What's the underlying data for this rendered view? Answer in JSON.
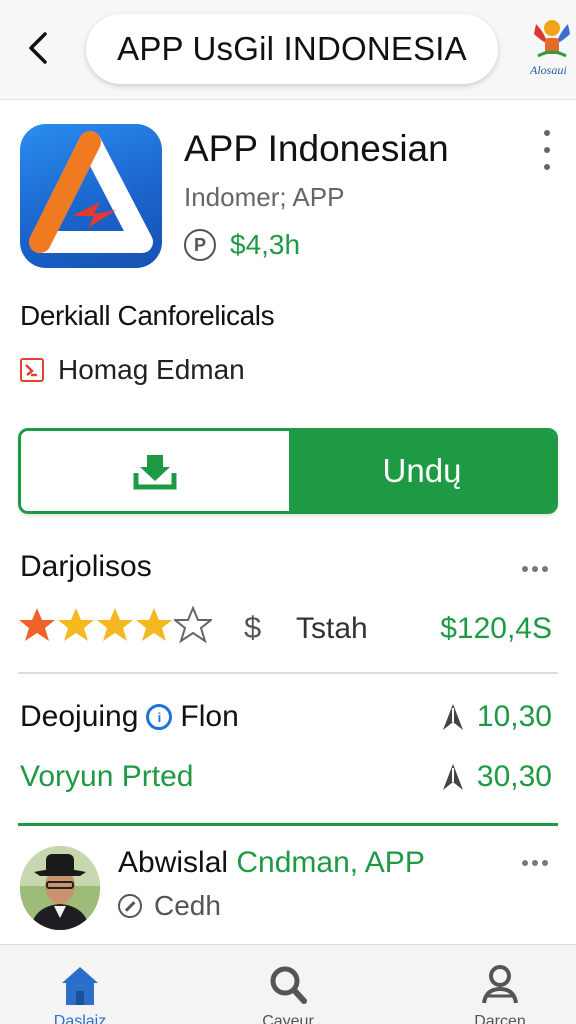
{
  "header": {
    "title": "APP UsGil INDONESIA",
    "brand_text": "Alosaui"
  },
  "app": {
    "name": "APP Indonesian",
    "developer": "Indomer; APP",
    "price_badge": "P",
    "price": "$4,3h",
    "category": "Derkiall Canforelicals",
    "author": "Homag Edman"
  },
  "actions": {
    "install_label": "Undų"
  },
  "ratings": {
    "section_title": "Darjolisos",
    "stars": 4,
    "max_stars": 5,
    "currency_symbol": "$",
    "label": "Tstah",
    "amount": "$120,4S"
  },
  "stats": [
    {
      "label": "Deojuing",
      "icon": "info-circle-icon",
      "label_suffix": "Flon",
      "value": "10,30",
      "label_color": "#111111"
    },
    {
      "label": "Voryun Prted",
      "icon": "",
      "label_suffix": "",
      "value": "30,30",
      "label_color": "#1f9a44"
    }
  ],
  "review": {
    "reviewer": "Abwislal",
    "organization": "Cndman, APP",
    "meta": "Cedh"
  },
  "bottom_nav": [
    {
      "label": "Daslaiz",
      "icon": "home-icon",
      "active": true
    },
    {
      "label": "Cayeur",
      "icon": "search-icon",
      "active": false
    },
    {
      "label": "Darcen",
      "icon": "profile-icon",
      "active": false
    }
  ],
  "colors": {
    "accent_green": "#1f9a44",
    "icon_blue": "#1a62c9",
    "star_gold": "#f5b820",
    "star_orange": "#f0622a"
  }
}
